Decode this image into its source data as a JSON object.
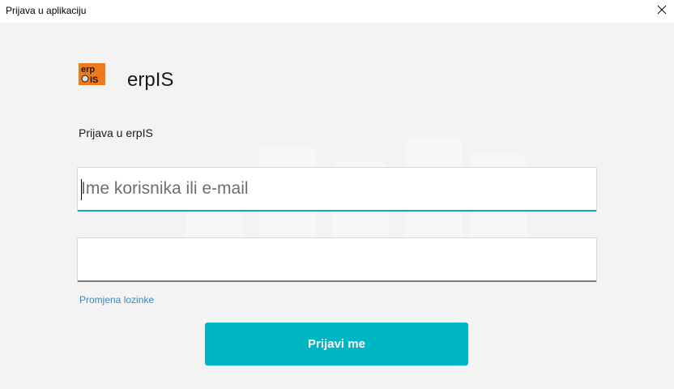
{
  "window": {
    "title": "Prijava u aplikaciju",
    "close_icon": "close-icon"
  },
  "app": {
    "name": "erpIS",
    "logo_text_top": "erp",
    "logo_text_bottom": "IS",
    "logo_icon": "erpis-logo"
  },
  "form": {
    "subtitle": "Prijava u erpIS",
    "username": {
      "value": "",
      "placeholder": "Ime korisnika ili e-mail"
    },
    "password": {
      "value": "",
      "placeholder": ""
    },
    "change_password_label": "Promjena lozinke",
    "submit_label": "Prijavi me"
  },
  "colors": {
    "accent": "#00b6c3",
    "focus_underline": "#1aa6b7",
    "link": "#3a87c8",
    "background": "#f3f3f3",
    "logo_orange": "#f07a1a"
  }
}
